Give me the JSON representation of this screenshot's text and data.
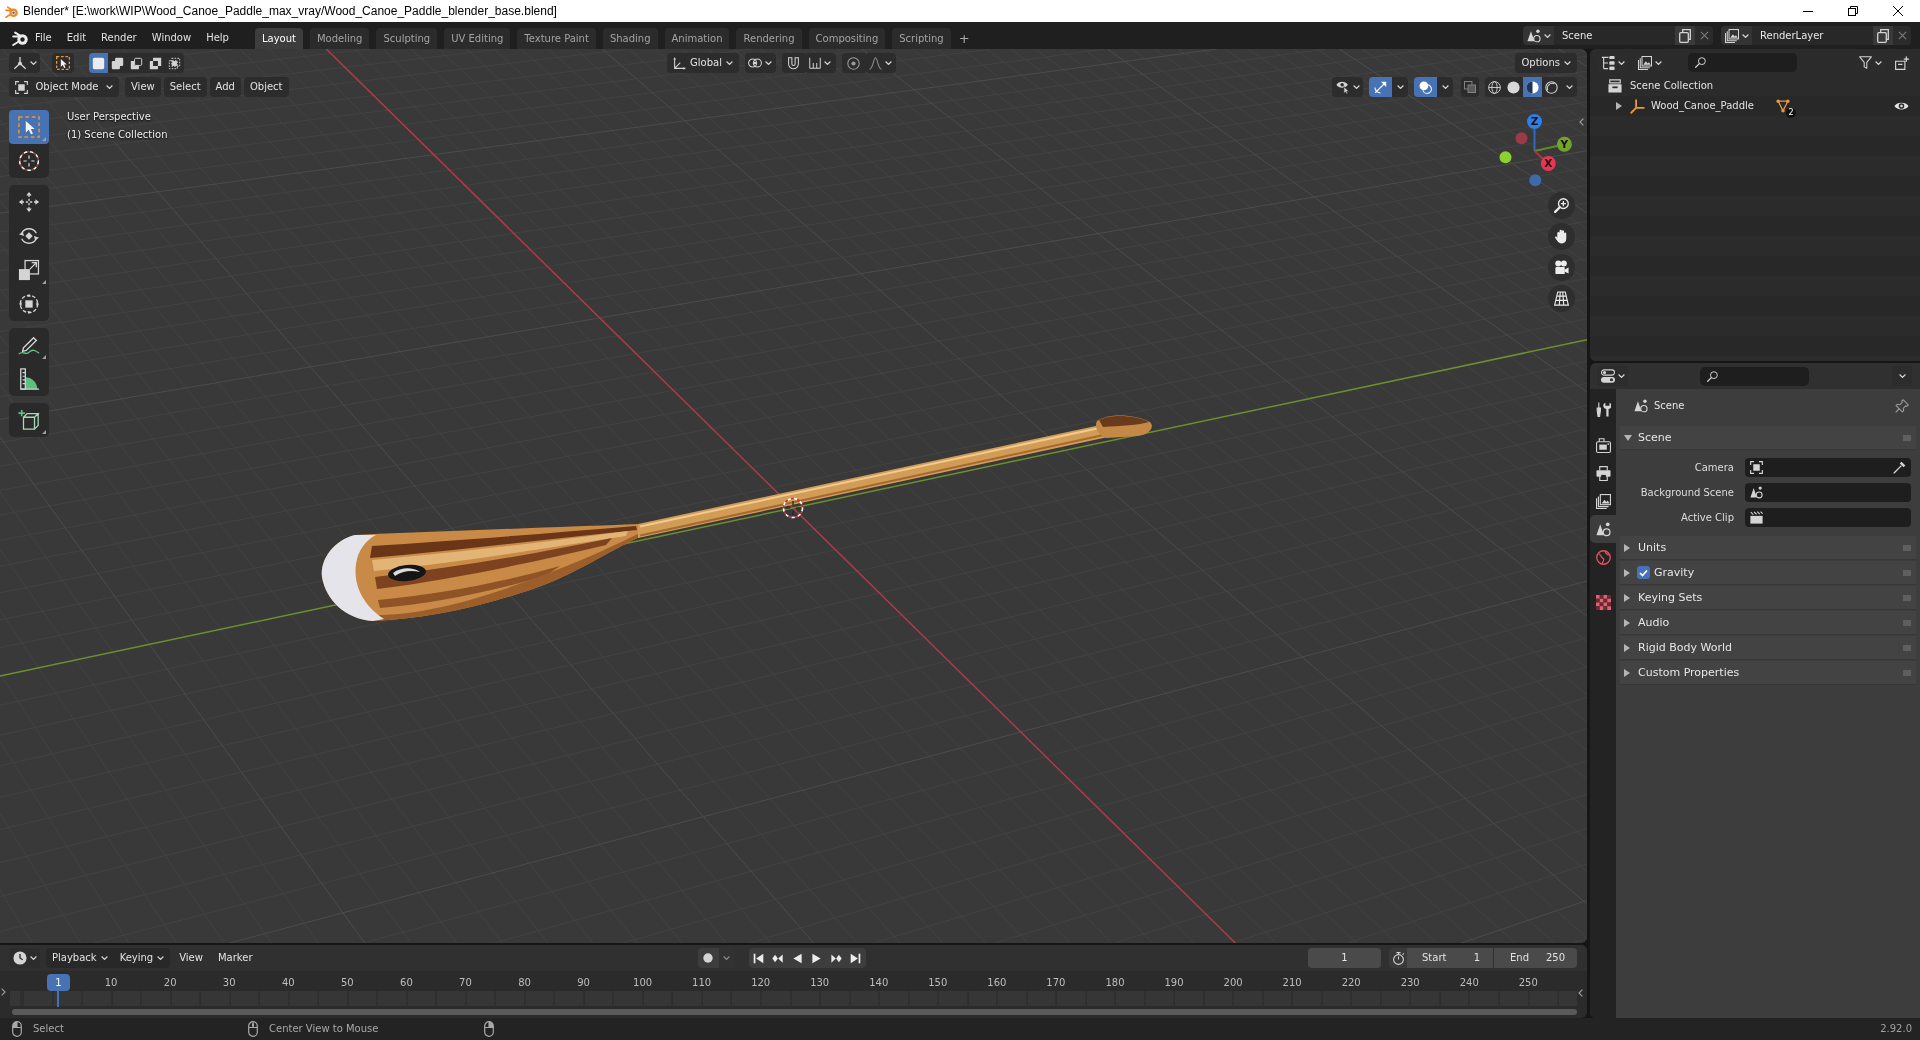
{
  "window": {
    "title": "Blender* [E:\\work\\WIP\\Wood_Canoe_Paddle_max_vray/Wood_Canoe_Paddle_blender_base.blend]"
  },
  "top_bar": {
    "menus": [
      "File",
      "Edit",
      "Render",
      "Window",
      "Help"
    ],
    "workspaces": [
      {
        "label": "Layout",
        "selected": true
      },
      {
        "label": "Modeling",
        "selected": false
      },
      {
        "label": "Sculpting",
        "selected": false
      },
      {
        "label": "UV Editing",
        "selected": false
      },
      {
        "label": "Texture Paint",
        "selected": false
      },
      {
        "label": "Shading",
        "selected": false
      },
      {
        "label": "Animation",
        "selected": false
      },
      {
        "label": "Rendering",
        "selected": false
      },
      {
        "label": "Compositing",
        "selected": false
      },
      {
        "label": "Scripting",
        "selected": false
      }
    ],
    "add_workspace": "+",
    "scene": "Scene",
    "view_layer": "RenderLayer"
  },
  "viewport": {
    "header": {
      "select_modes": [
        {
          "selected": true
        },
        {
          "selected": false
        },
        {
          "selected": false
        },
        {
          "selected": false
        },
        {
          "selected": false
        }
      ],
      "orientation": "Global",
      "options": "Options",
      "mode": "Object Mode",
      "menus": [
        "View",
        "Select",
        "Add",
        "Object"
      ],
      "gizmos_on": true,
      "overlays_on": true,
      "xray_on": false,
      "shading": [
        {
          "selected": false
        },
        {
          "selected": false
        },
        {
          "selected": true
        },
        {
          "selected": false
        }
      ]
    },
    "tools": [
      {
        "selected": true
      },
      {
        "selected": false
      },
      {
        "selected": false
      },
      {
        "selected": false
      },
      {
        "selected": false
      },
      {
        "selected": false
      },
      {
        "selected": false
      },
      {
        "selected": false
      },
      {
        "selected": false
      }
    ],
    "info": [
      "User Perspective",
      "(1) Scene Collection"
    ],
    "gizmo_axes": [
      "Z",
      "Y",
      "X"
    ]
  },
  "outliner": {
    "root": "Scene Collection",
    "items": [
      {
        "label": "Wood_Canoe_Paddle",
        "expanded": false,
        "badge": "2",
        "visible": true
      }
    ]
  },
  "properties": {
    "tabs": [
      {
        "selected": false
      },
      {
        "selected": false
      },
      {
        "selected": false
      },
      {
        "selected": false
      },
      {
        "selected": true
      },
      {
        "selected": false
      },
      {
        "selected": false
      }
    ],
    "context": "Scene",
    "panels": [
      {
        "title": "Scene",
        "expanded": true,
        "fields": [
          "Camera",
          "Background Scene",
          "Active Clip"
        ]
      },
      {
        "title": "Units",
        "expanded": false
      },
      {
        "title": "Gravity",
        "expanded": false,
        "toggle": {
          "checked": true
        }
      },
      {
        "title": "Keying Sets",
        "expanded": false
      },
      {
        "title": "Audio",
        "expanded": false
      },
      {
        "title": "Rigid Body World",
        "expanded": false
      },
      {
        "title": "Custom Properties",
        "expanded": false
      }
    ]
  },
  "timeline": {
    "menus": [
      {
        "label": "Playback",
        "kind": "dropdown"
      },
      {
        "label": "Keying",
        "kind": "dropdown"
      },
      {
        "label": "View",
        "kind": "menu"
      },
      {
        "label": "Marker",
        "kind": "menu"
      }
    ],
    "current_frame": "1",
    "start_label": "Start",
    "start": "1",
    "end_label": "End",
    "end": "250",
    "playhead": "1",
    "ruler": [
      "10",
      "20",
      "30",
      "40",
      "50",
      "60",
      "70",
      "80",
      "90",
      "100",
      "110",
      "120",
      "130",
      "140",
      "150",
      "160",
      "170",
      "180",
      "190",
      "200",
      "210",
      "220",
      "230",
      "240",
      "250"
    ]
  },
  "status_bar": {
    "hints": [
      "Select",
      "Center View to Mouse"
    ],
    "version": "2.92.0"
  }
}
